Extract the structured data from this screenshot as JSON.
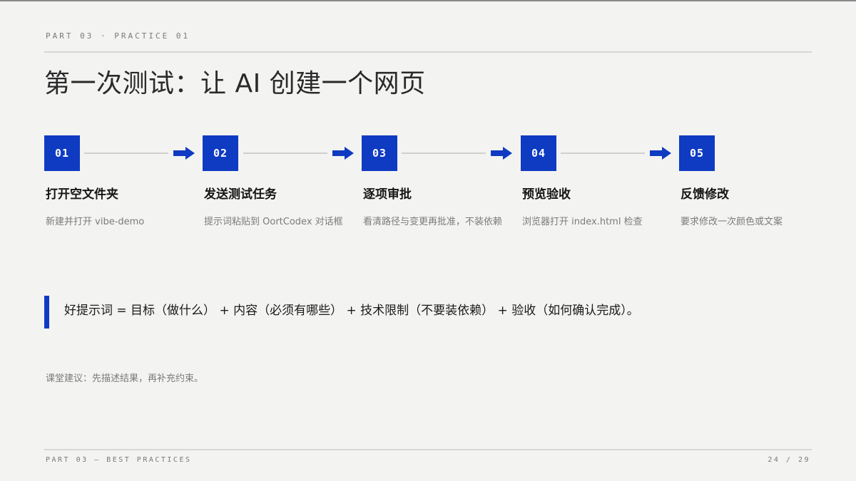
{
  "header": {
    "kicker": "PART 03 · PRACTICE 01",
    "title": "第一次测试：让 AI 创建一个网页"
  },
  "steps": [
    {
      "number": "01",
      "title": "打开空文件夹",
      "desc": "新建并打开 vibe-demo"
    },
    {
      "number": "02",
      "title": "发送测试任务",
      "desc": "提示词粘贴到 OortCodex 对话框"
    },
    {
      "number": "03",
      "title": "逐项审批",
      "desc": "看清路径与变更再批准，不装依赖"
    },
    {
      "number": "04",
      "title": "预览验收",
      "desc": "浏览器打开 index.html 检查"
    },
    {
      "number": "05",
      "title": "反馈修改",
      "desc": "要求修改一次颜色或文案"
    }
  ],
  "callout": {
    "text": "好提示词 = 目标（做什么） + 内容（必须有哪些） + 技术限制（不要装依赖） + 验收（如何确认完成）。"
  },
  "note": "课堂建议：先描述结果，再补充约束。",
  "footer": {
    "section": "PART 03 — BEST PRACTICES",
    "page": "24 / 29"
  },
  "colors": {
    "accent": "#0f3bc2",
    "background": "#f3f3f2",
    "muted_text": "#7b7b7b"
  },
  "icons": {
    "step_arrow": "arrow-right-icon"
  }
}
